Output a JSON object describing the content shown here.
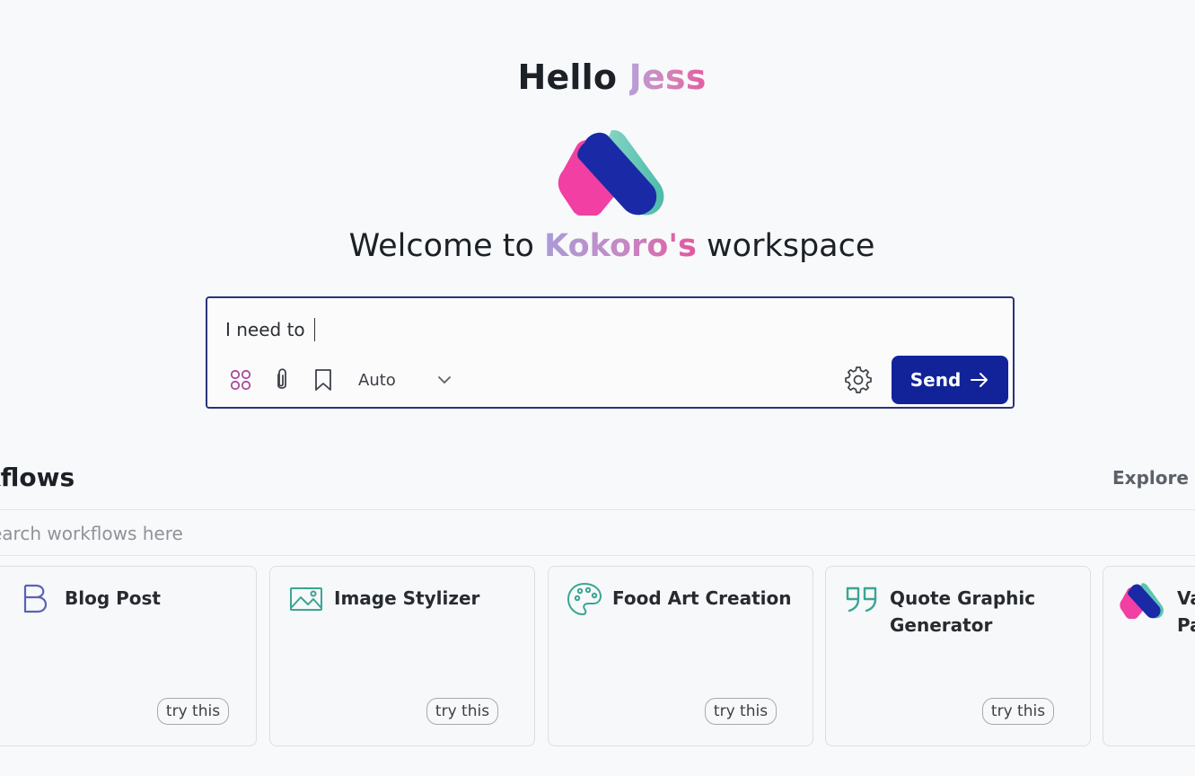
{
  "greeting": {
    "prefix": "Hello",
    "name": "Jess"
  },
  "welcome": {
    "prefix": "Welcome to",
    "brand": "Kokoro's",
    "suffix": "workspace"
  },
  "prompt": {
    "value": "I need to",
    "mode": "Auto",
    "send_label": "Send",
    "icons": [
      "apps-icon",
      "paperclip-icon",
      "bookmark-icon",
      "chevron-down-icon",
      "gear-icon",
      "arrow-right-icon"
    ]
  },
  "workflows": {
    "title": "kflows",
    "explore_label": "Explore n",
    "search_placeholder": "earch workflows here",
    "cards": [
      {
        "title": "Blog Post",
        "icon": "letter-b-icon",
        "try_label": "try this"
      },
      {
        "title": "Image Stylizer",
        "icon": "image-icon",
        "try_label": "try this"
      },
      {
        "title": "Food Art Creation",
        "icon": "palette-icon",
        "try_label": "try this"
      },
      {
        "title": "Quote Graphic Generator",
        "icon": "quote-icon",
        "try_label": "try this"
      },
      {
        "title": "Va\nPa",
        "icon": "kokoro-logo-icon",
        "try_label": ""
      }
    ]
  },
  "colors": {
    "accent_navy": "#12239a",
    "box_border": "#2a3477",
    "logo_pink": "#f13fa4",
    "logo_navy": "#1a2aa6",
    "logo_teal": "#5cc5b3"
  }
}
